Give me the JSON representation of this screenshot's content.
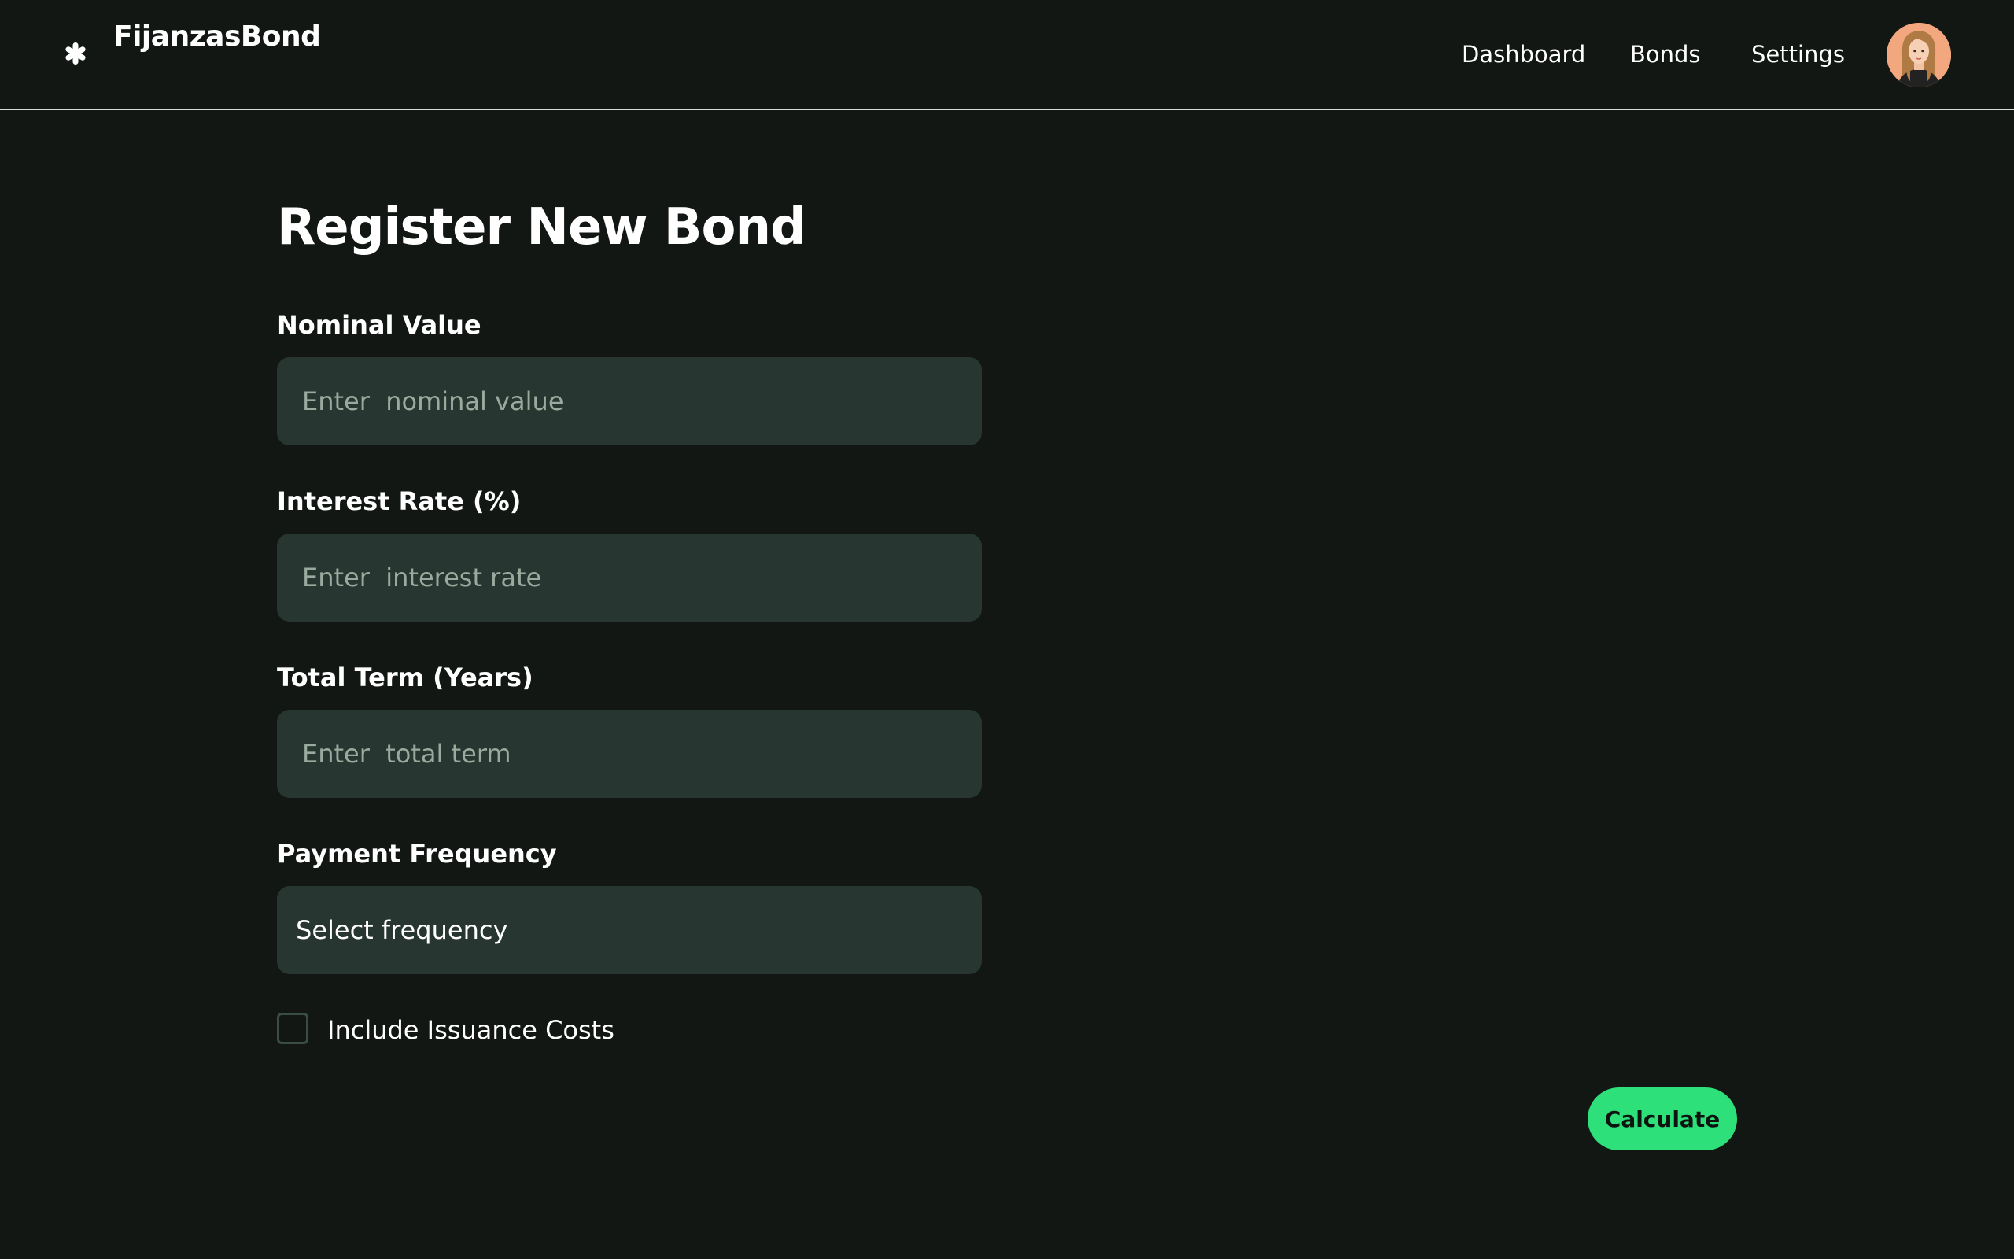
{
  "app": {
    "brand": "FijanzasBond",
    "logo_icon": "asterisk-icon"
  },
  "nav": {
    "items": [
      {
        "label": "Dashboard"
      },
      {
        "label": "Bonds"
      },
      {
        "label": "Settings"
      }
    ],
    "avatar_icon": "user-avatar"
  },
  "form": {
    "title": "Register New Bond",
    "nominal": {
      "label": "Nominal Value",
      "placeholder": "Enter  nominal value",
      "value": ""
    },
    "rate": {
      "label": "Interest Rate (%)",
      "placeholder": "Enter  interest rate",
      "value": ""
    },
    "term": {
      "label": "Total Term (Years)",
      "placeholder": "Enter  total term",
      "value": ""
    },
    "frequency": {
      "label": "Payment Frequency",
      "selected": "Select  frequency"
    },
    "issuance": {
      "label": "Include Issuance Costs",
      "checked": false
    },
    "submit_label": "Calculate"
  },
  "colors": {
    "background": "#121714",
    "input_bg": "#273630",
    "placeholder": "#99ab9f",
    "accent": "#2ee07a",
    "header_border": "#d7dcd9"
  }
}
